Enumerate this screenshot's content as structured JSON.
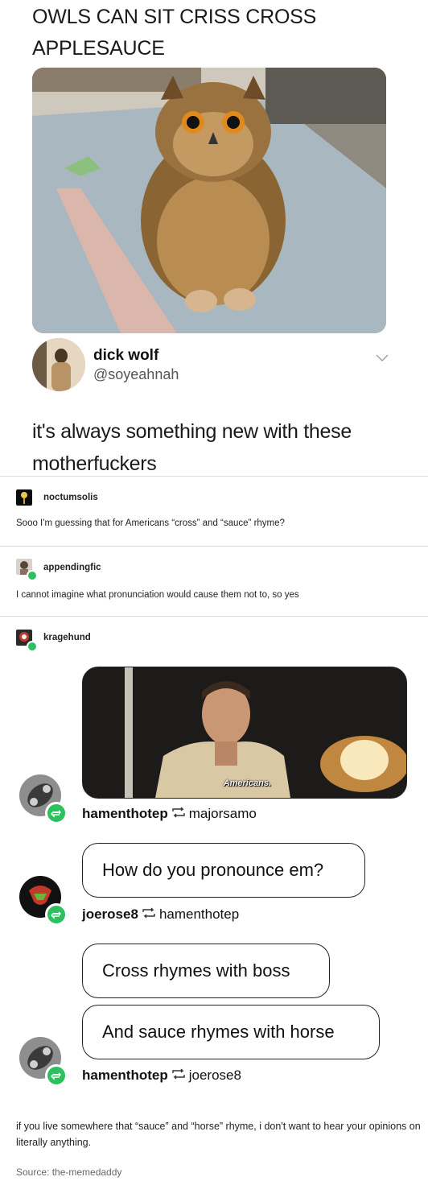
{
  "tweet": {
    "caption": "OWLS CAN SIT CRISS CROSS APPLESAUCE",
    "author_name": "dick wolf",
    "author_handle": "@soyeahnah",
    "text": "it's always something new with these motherfuckers"
  },
  "posts": [
    {
      "username": "noctumsolis",
      "text": "Sooo I'm guessing that for Americans “cross” and “sauce” rhyme?"
    },
    {
      "username": "appendingfic",
      "text": "I cannot imagine what pronunciation would cause them not to, so yes"
    },
    {
      "username": "kragehund"
    }
  ],
  "reaction_image": {
    "caption": "Americans."
  },
  "reblogs": [
    {
      "user": "hamenthotep",
      "from": "majorsamo"
    },
    {
      "user": "joerose8",
      "from": "hamenthotep"
    },
    {
      "user": "hamenthotep",
      "from": "joerose8"
    }
  ],
  "bubbles": {
    "b1": "How do you pronounce em?",
    "b2": "Cross rhymes with boss",
    "b3": "And sauce rhymes with horse"
  },
  "footer": {
    "text": "if you live somewhere that “sauce” and “horse” rhyme, i don't want to hear your opinions on literally anything.",
    "source": "Source:   the-memedaddy"
  },
  "colors": {
    "reblog_green": "#2cc05f",
    "divider": "#dcdcdc"
  }
}
